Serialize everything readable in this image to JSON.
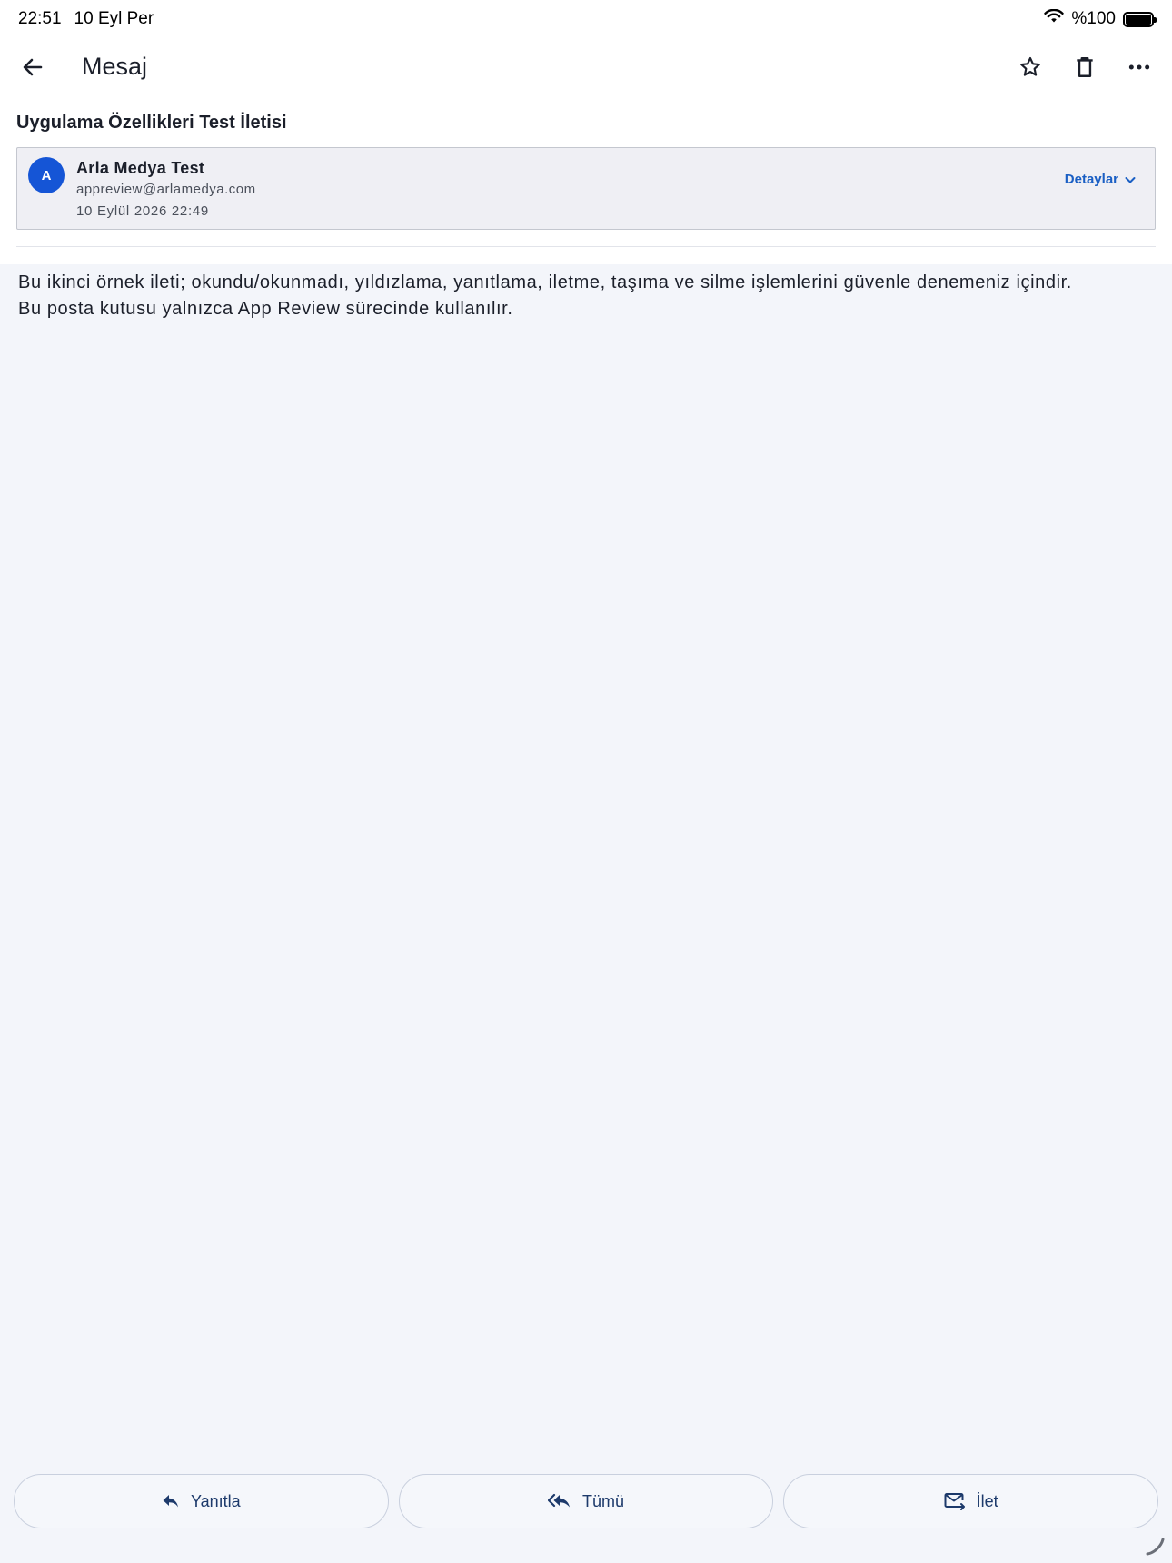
{
  "status_bar": {
    "time": "22:51",
    "date": "10 Eyl Per",
    "battery": "%100",
    "icons": [
      "wifi-icon",
      "battery-icon"
    ]
  },
  "nav": {
    "title": "Mesaj",
    "back_icon": "arrow-left-icon",
    "actions": [
      "star-icon",
      "trash-icon",
      "more-icon"
    ]
  },
  "message": {
    "subject": "Uygulama Özellikleri Test İletisi",
    "sender": {
      "initial": "A",
      "name": "Arla Medya Test",
      "email": "appreview@arlamedya.com",
      "date": "10 Eylül 2026 22:49"
    },
    "details_label": "Detaylar",
    "body_line1": "Bu ikinci örnek ileti; okundu/okunmadı, yıldızlama, yanıtlama, iletme, taşıma ve silme işlemlerini güvenle denemeniz içindir.",
    "body_line2": "Bu posta kutusu yalnızca App Review sürecinde kullanılır."
  },
  "actions": {
    "reply": "Yanıtla",
    "reply_all": "Tümü",
    "forward": "İlet"
  },
  "colors": {
    "accent": "#1555d6",
    "link": "#1a5fc4",
    "background": "#f3f5fa"
  }
}
